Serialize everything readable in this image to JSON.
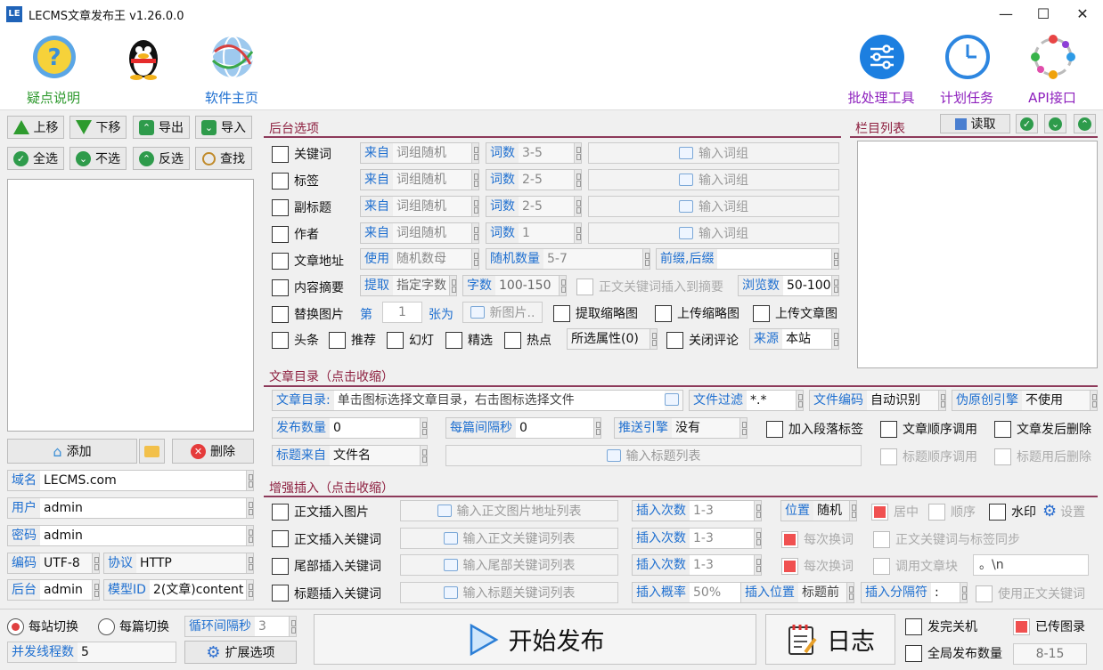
{
  "app": {
    "logo": "LE",
    "title": "LECMS文章发布王 v1.26.0.0",
    "min": "—",
    "max": "☐",
    "close": "✕"
  },
  "toolbar": {
    "help": "疑点说明",
    "home": "软件主页",
    "batch": "批处理工具",
    "schedule": "计划任务",
    "api": "API接口"
  },
  "left": {
    "up": "上移",
    "down": "下移",
    "export": "导出",
    "import": "导入",
    "selall": "全选",
    "selnone": "不选",
    "invert": "反选",
    "find": "查找",
    "add": "添加",
    "del": "删除",
    "domain_k": "域名",
    "domain_v": "LECMS.com",
    "user_k": "用户",
    "user_v": "admin",
    "pwd_k": "密码",
    "pwd_v": "admin",
    "enc_k": "编码",
    "enc_v": "UTF-8",
    "proto_k": "协议",
    "proto_v": "HTTP",
    "bk_k": "后台",
    "bk_v": "admin",
    "model_k": "模型ID",
    "model_v": "2(文章)content"
  },
  "backend": {
    "title": "后台选项",
    "rows": [
      {
        "label": "关键词",
        "src_k": "来自",
        "src_v": "词组随机",
        "cnt_k": "词数",
        "cnt_v": "3-5",
        "btn": "输入词组"
      },
      {
        "label": "标签",
        "src_k": "来自",
        "src_v": "词组随机",
        "cnt_k": "词数",
        "cnt_v": "2-5",
        "btn": "输入词组"
      },
      {
        "label": "副标题",
        "src_k": "来自",
        "src_v": "词组随机",
        "cnt_k": "词数",
        "cnt_v": "2-5",
        "btn": "输入词组"
      },
      {
        "label": "作者",
        "src_k": "来自",
        "src_v": "词组随机",
        "cnt_k": "词数",
        "cnt_v": "1",
        "btn": "输入词组"
      }
    ],
    "url_label": "文章地址",
    "url_k": "使用",
    "url_v": "随机数母",
    "rand_k": "随机数量",
    "rand_v": "5-7",
    "prefix_k": "前缀,后缀",
    "prefix_v": "",
    "sum_label": "内容摘要",
    "sum_k": "提取",
    "sum_v": "指定字数",
    "words_k": "字数",
    "words_v": "100-150",
    "sum_ins": "正文关键词插入到摘要",
    "views_k": "浏览数",
    "views_v": "50-100",
    "img_label": "替换图片",
    "img_nth": "第",
    "img_n": "1",
    "img_unit": "张为",
    "img_btn": "新图片..",
    "thumb": "提取缩略图",
    "up_thumb": "上传缩略图",
    "up_img": "上传文章图",
    "flags": [
      "头条",
      "推荐",
      "幻灯",
      "精选",
      "热点"
    ],
    "attr": "所选属性(0)",
    "close_cmt": "关闭评论",
    "source_k": "来源",
    "source_v": "本站"
  },
  "catlist": {
    "title": "栏目列表",
    "read": "读取"
  },
  "dir": {
    "title": "文章目录（点击收缩）",
    "dir_k": "文章目录:",
    "dir_v": "单击图标选择文章目录，右击图标选择文件",
    "filter_k": "文件过滤",
    "filter_v": "*.*",
    "enc_k": "文件编码",
    "enc_v": "自动识别",
    "orig_k": "伪原创引擎",
    "orig_v": "不使用",
    "pubcnt_k": "发布数量",
    "pubcnt_v": "0",
    "interval_k": "每篇间隔秒",
    "interval_v": "0",
    "push_k": "推送引擎",
    "push_v": "没有",
    "para_tag": "加入段落标签",
    "seq": "文章顺序调用",
    "del_after": "文章发后删除",
    "title_k": "标题来自",
    "title_v": "文件名",
    "title_btn": "输入标题列表",
    "title_seq": "标题顺序调用",
    "title_del": "标题用后删除"
  },
  "enh": {
    "title": "增强插入（点击收缩）",
    "rows": [
      {
        "label": "正文插入图片",
        "btn": "输入正文图片地址列表",
        "k": "插入次数",
        "v": "1-3"
      },
      {
        "label": "正文插入关键词",
        "btn": "输入正文关键词列表",
        "k": "插入次数",
        "v": "1-3"
      },
      {
        "label": "尾部插入关键词",
        "btn": "输入尾部关键词列表",
        "k": "插入次数",
        "v": "1-3"
      },
      {
        "label": "标题插入关键词",
        "btn": "输入标题关键词列表",
        "k": "插入概率",
        "v": "50%"
      }
    ],
    "pos_k": "位置",
    "pos_v": "随机",
    "center": "居中",
    "order": "顺序",
    "watermark": "水印",
    "settings": "设置",
    "each1": "每次换词",
    "sync": "正文关键词与标签同步",
    "each2": "每次换词",
    "callblock": "调用文章块",
    "callblock_v": "。\\n",
    "inspos_k": "插入位置",
    "inspos_v": "标题前",
    "sep_k": "插入分隔符",
    "sep_v": ":",
    "use_kw": "使用正文关键词"
  },
  "bottom": {
    "per_site": "每站切换",
    "per_post": "每篇切换",
    "loop_k": "循环间隔秒",
    "loop_v": "3",
    "threads_k": "并发线程数",
    "threads_v": "5",
    "ext": "扩展选项",
    "start": "开始发布",
    "log": "日志",
    "shutdown": "发完关机",
    "uploaded": "已传图录",
    "global": "全局发布数量",
    "global_v": "8-15"
  }
}
